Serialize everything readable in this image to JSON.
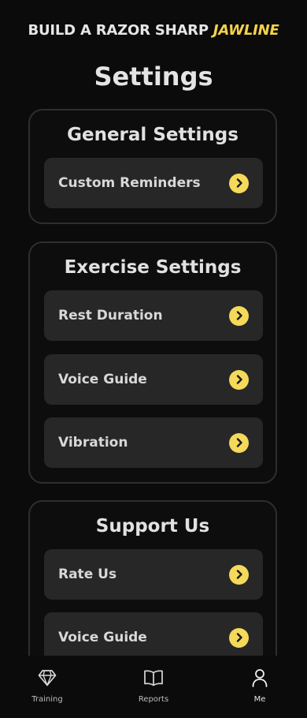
{
  "header": {
    "brand_prefix": "BUILD A RAZOR SHARP",
    "brand_accent": "JAWLINE"
  },
  "page": {
    "title": "Settings"
  },
  "sections": [
    {
      "title": "General Settings",
      "items": [
        {
          "label": "Custom Reminders",
          "icon": "chevron-right-icon"
        }
      ]
    },
    {
      "title": "Exercise Settings",
      "items": [
        {
          "label": "Rest Duration",
          "icon": "chevron-right-icon"
        },
        {
          "label": "Voice Guide",
          "icon": "chevron-right-icon"
        },
        {
          "label": "Vibration",
          "icon": "chevron-right-icon"
        }
      ]
    },
    {
      "title": "Support Us",
      "items": [
        {
          "label": "Rate Us",
          "icon": "chevron-right-icon"
        },
        {
          "label": "Voice Guide",
          "icon": "chevron-right-icon"
        }
      ]
    }
  ],
  "tabbar": {
    "tabs": [
      {
        "label": "Training",
        "icon": "diamond-icon"
      },
      {
        "label": "Reports",
        "icon": "book-icon"
      },
      {
        "label": "Me",
        "icon": "person-icon",
        "active": true
      }
    ]
  },
  "colors": {
    "background": "#0b0b0b",
    "card": "#272727",
    "accent": "#f4d95a",
    "brand_accent": "#f4d24a"
  }
}
